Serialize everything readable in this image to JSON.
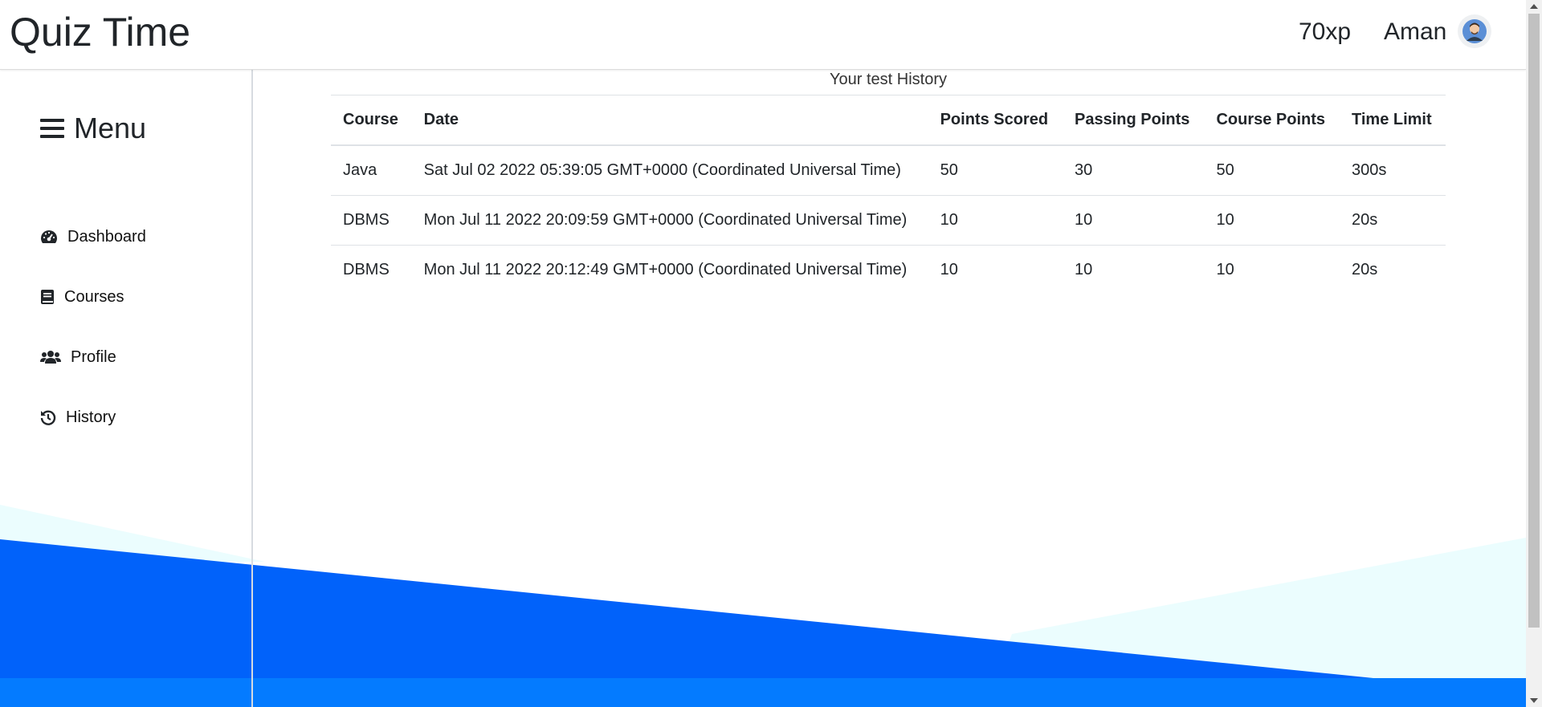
{
  "header": {
    "brand": "Quiz Time",
    "xp": "70xp",
    "username": "Aman"
  },
  "sidebar": {
    "menu_label": "Menu",
    "items": [
      {
        "label": "Dashboard",
        "icon": "gauge-icon"
      },
      {
        "label": "Courses",
        "icon": "book-icon"
      },
      {
        "label": "Profile",
        "icon": "users-icon"
      },
      {
        "label": "History",
        "icon": "history-icon"
      }
    ]
  },
  "history": {
    "caption": "Your test History",
    "columns": [
      "Course",
      "Date",
      "Points Scored",
      "Passing Points",
      "Course Points",
      "Time Limit"
    ],
    "rows": [
      [
        "Java",
        "Sat Jul 02 2022 05:39:05 GMT+0000 (Coordinated Universal Time)",
        "50",
        "30",
        "50",
        "300s"
      ],
      [
        "DBMS",
        "Mon Jul 11 2022 20:09:59 GMT+0000 (Coordinated Universal Time)",
        "10",
        "10",
        "10",
        "20s"
      ],
      [
        "DBMS",
        "Mon Jul 11 2022 20:12:49 GMT+0000 (Coordinated Universal Time)",
        "10",
        "10",
        "10",
        "20s"
      ]
    ]
  },
  "colors": {
    "wave_dark": "#0162fa",
    "wave_light": "#ebfdfe",
    "footer_band": "#047bff"
  }
}
